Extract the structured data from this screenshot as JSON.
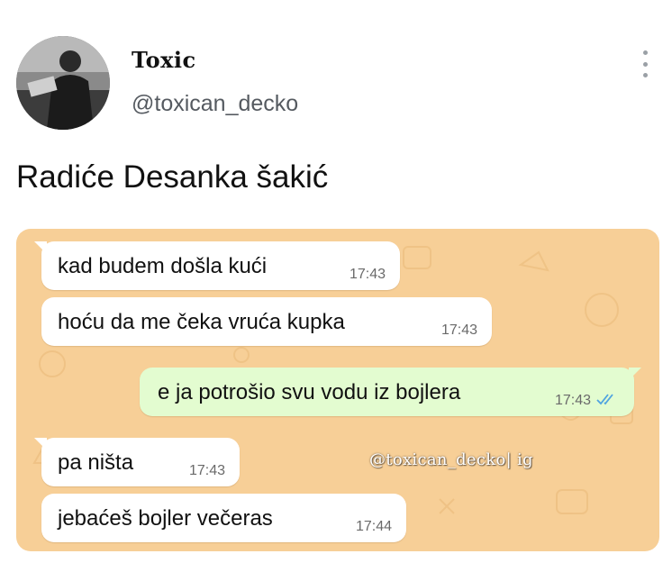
{
  "author": {
    "display_name": "Toxic",
    "handle": "@toxican_decko"
  },
  "tweet": {
    "text": "Radiće Desanka šakić"
  },
  "chat": {
    "messages": [
      {
        "direction": "in",
        "text": "kad budem došla kući",
        "time": "17:43"
      },
      {
        "direction": "in",
        "text": "hoću da me čeka vruća kupka",
        "time": "17:43"
      },
      {
        "direction": "out",
        "text": "e ja potrošio svu vodu iz bojlera",
        "time": "17:43",
        "status": "read"
      },
      {
        "direction": "in",
        "text": "pa ništa",
        "time": "17:43"
      },
      {
        "direction": "in",
        "text": "jebaćeš bojler večeras",
        "time": "17:44"
      }
    ],
    "watermark": "@toxican_decko| ig"
  },
  "colors": {
    "chat_background": "#f7cf97",
    "incoming_bubble": "#ffffff",
    "outgoing_bubble": "#e3fcd0",
    "read_ticks": "#4fa3e0"
  },
  "icons": {
    "more_menu": "vertical-ellipsis-icon",
    "read_status": "double-check-icon"
  }
}
